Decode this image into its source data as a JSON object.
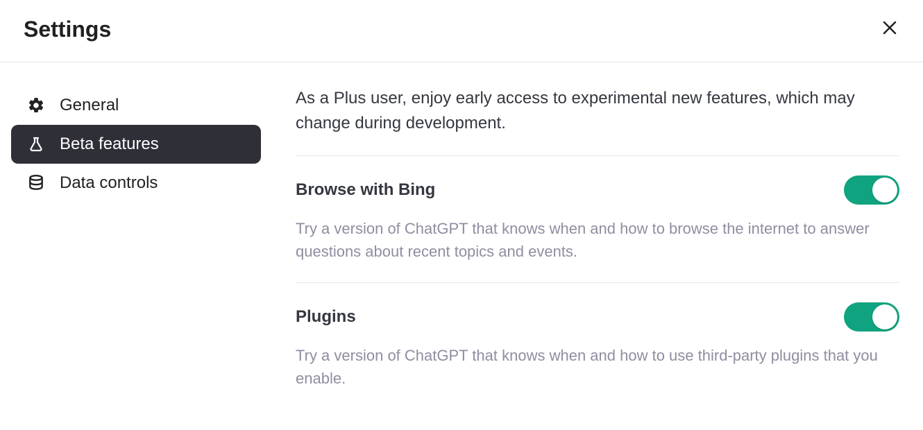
{
  "header": {
    "title": "Settings"
  },
  "sidebar": {
    "items": [
      {
        "label": "General"
      },
      {
        "label": "Beta features"
      },
      {
        "label": "Data controls"
      }
    ]
  },
  "content": {
    "intro": "As a Plus user, enjoy early access to experimental new features, which may change during development.",
    "features": [
      {
        "title": "Browse with Bing",
        "description": "Try a version of ChatGPT that knows when and how to browse the internet to answer questions about recent topics and events.",
        "enabled": true
      },
      {
        "title": "Plugins",
        "description": "Try a version of ChatGPT that knows when and how to use third-party plugins that you enable.",
        "enabled": true
      }
    ]
  }
}
